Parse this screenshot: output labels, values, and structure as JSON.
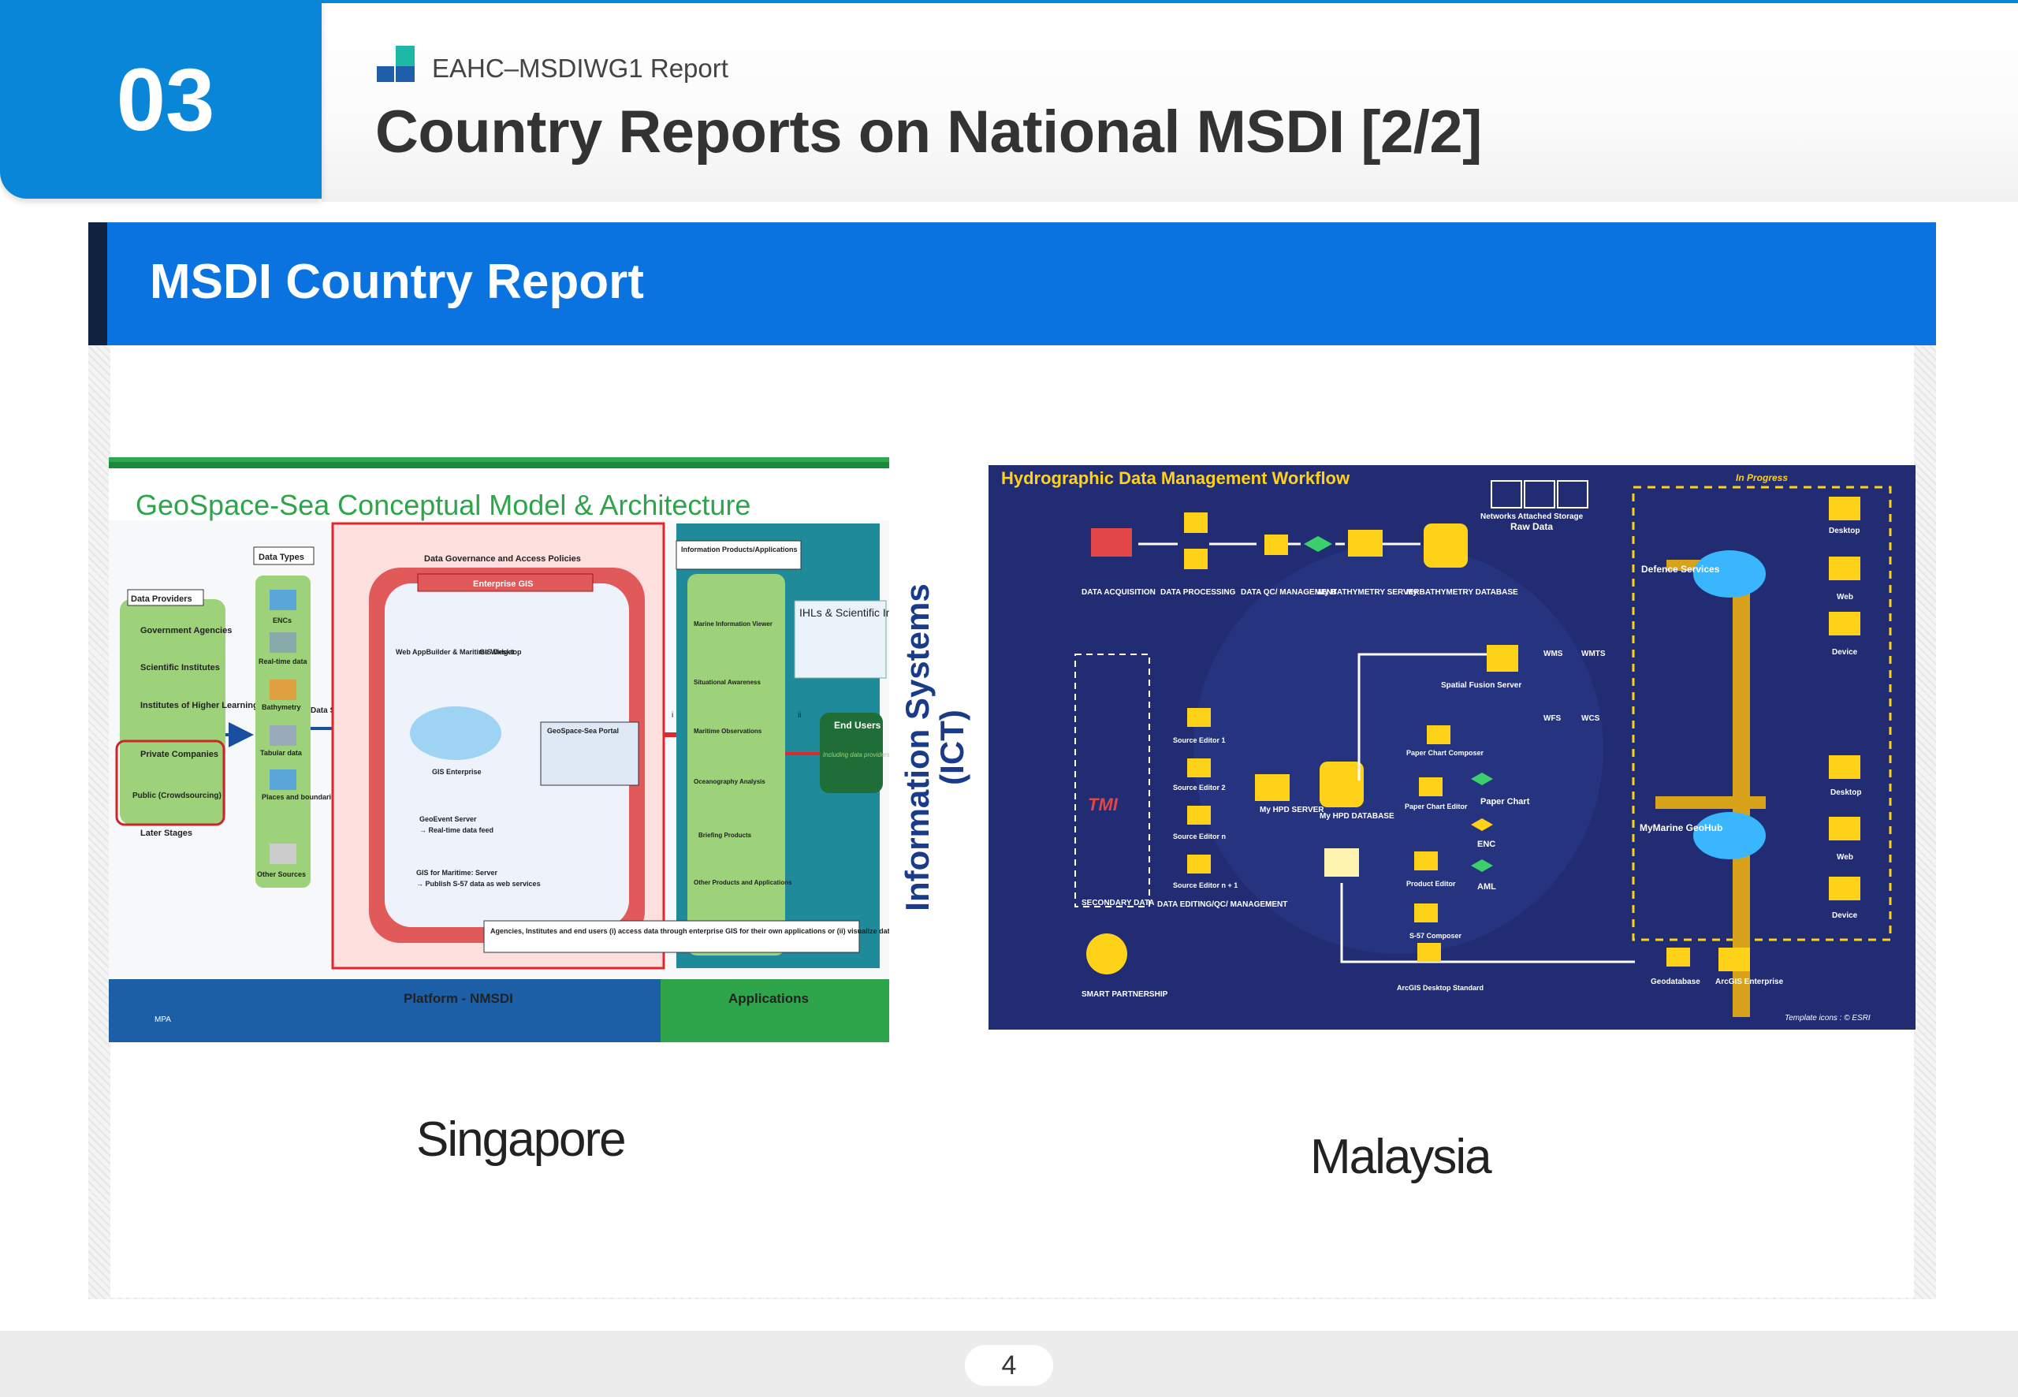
{
  "header": {
    "section_number": "03",
    "report_label": "EAHC–MSDIWG1 Report",
    "title": "Country Reports on National MSDI [2/2]"
  },
  "banner": {
    "title": "MSDI Country Report"
  },
  "singapore_diagram": {
    "title": "GeoSpace-Sea Conceptual Model & Architecture",
    "data_providers": {
      "header": "Data Providers",
      "items": [
        "Government Agencies",
        "Scientific Institutes",
        "Institutes of Higher Learning",
        "Private Companies",
        "Public (Crowdsourcing)"
      ],
      "later": "Later Stages"
    },
    "data_types": {
      "header": "Data Types",
      "items": [
        "ENCs",
        "Real-time data",
        "Bathymetry",
        "Tabular data",
        "Places and boundaries",
        "Other Sources"
      ]
    },
    "data_sharing": "Data Sharing",
    "governance": "Data Governance and Access Policies",
    "enterprise_gis": "Enterprise GIS",
    "web_appbuilder": "Web AppBuilder & Maritime Widget",
    "gis_desktop": "GIS Desktop",
    "gis_enterprise": "GIS Enterprise",
    "geospace_portal": "GeoSpace-Sea Portal",
    "geoevent": "GeoEvent Server",
    "realtime_feed": "→ Real-time data feed",
    "gis_maritime": "GIS for Maritime: Server",
    "publish_s57": "→ Publish S-57 data as web services",
    "info_products": "Information Products/Applications",
    "products": [
      "Marine Information Viewer",
      "Situational Awareness",
      "Maritime Observations",
      "Oceanography Analysis",
      "Briefing Products",
      "Other Products and Applications"
    ],
    "ihls": "IHLs & Scientific Institutes, eg TMSI",
    "end_users": "End Users",
    "end_users_note": "Including data providers",
    "access_note": "Agencies, Institutes and end users (i) access data through enterprise GIS for their own applications or (ii) visualize data through built-in applications",
    "platform": "Platform - NMSDI",
    "applications": "Applications",
    "mpa": "MPA",
    "marker_i": "i",
    "marker_ii": "ii"
  },
  "ict_label": {
    "line1": "Information Systems",
    "line2": "(ICT)"
  },
  "malaysia_diagram": {
    "title": "Hydrographic Data Management Workflow",
    "in_progress": "In Progress",
    "nas": "Networks Attached Storage",
    "raw_data": "Raw Data",
    "stages": [
      "DATA ACQUISITION",
      "DATA PROCESSING",
      "DATA QC/ MANAGEMENT",
      "My BATHYMETRY SERVER",
      "My BATHYMETRY DATABASE"
    ],
    "spatial_fusion": "Spatial Fusion Server",
    "services": [
      "WMS",
      "WMTS",
      "WFS",
      "WCS"
    ],
    "defence": "Defence Services",
    "mymarine": "MyMarine GeoHub",
    "clients": [
      "Desktop",
      "Web",
      "Device"
    ],
    "secondary_data": "SECONDARY DATA",
    "editors": [
      "Source Editor 1",
      "Source Editor 2",
      "Source Editor n",
      "Source Editor n + 1"
    ],
    "editing": "DATA EDITING/QC/ MANAGEMENT",
    "hpd_server": "My HPD SERVER",
    "hpd_db": "My HPD DATABASE",
    "paper_composer": "Paper Chart Composer",
    "paper_editor": "Paper Chart Editor",
    "paper_chart": "Paper Chart",
    "product_editor": "Product Editor",
    "enc": "ENC",
    "aml": "AML",
    "s57": "S-57 Composer",
    "arcgis_desktop": "ArcGIS Desktop Standard",
    "geodatabase": "Geodatabase",
    "arcgis_enterprise": "ArcGIS Enterprise",
    "smart": "SMART PARTNERSHIP",
    "template": "Template icons : © ESRI",
    "tmi": "TMI"
  },
  "captions": {
    "left": "Singapore",
    "right": "Malaysia"
  },
  "footer": {
    "page_number": "4"
  },
  "colors": {
    "accent": "#0a86d8",
    "banner": "#0a73e0",
    "title_text": "#333333"
  }
}
